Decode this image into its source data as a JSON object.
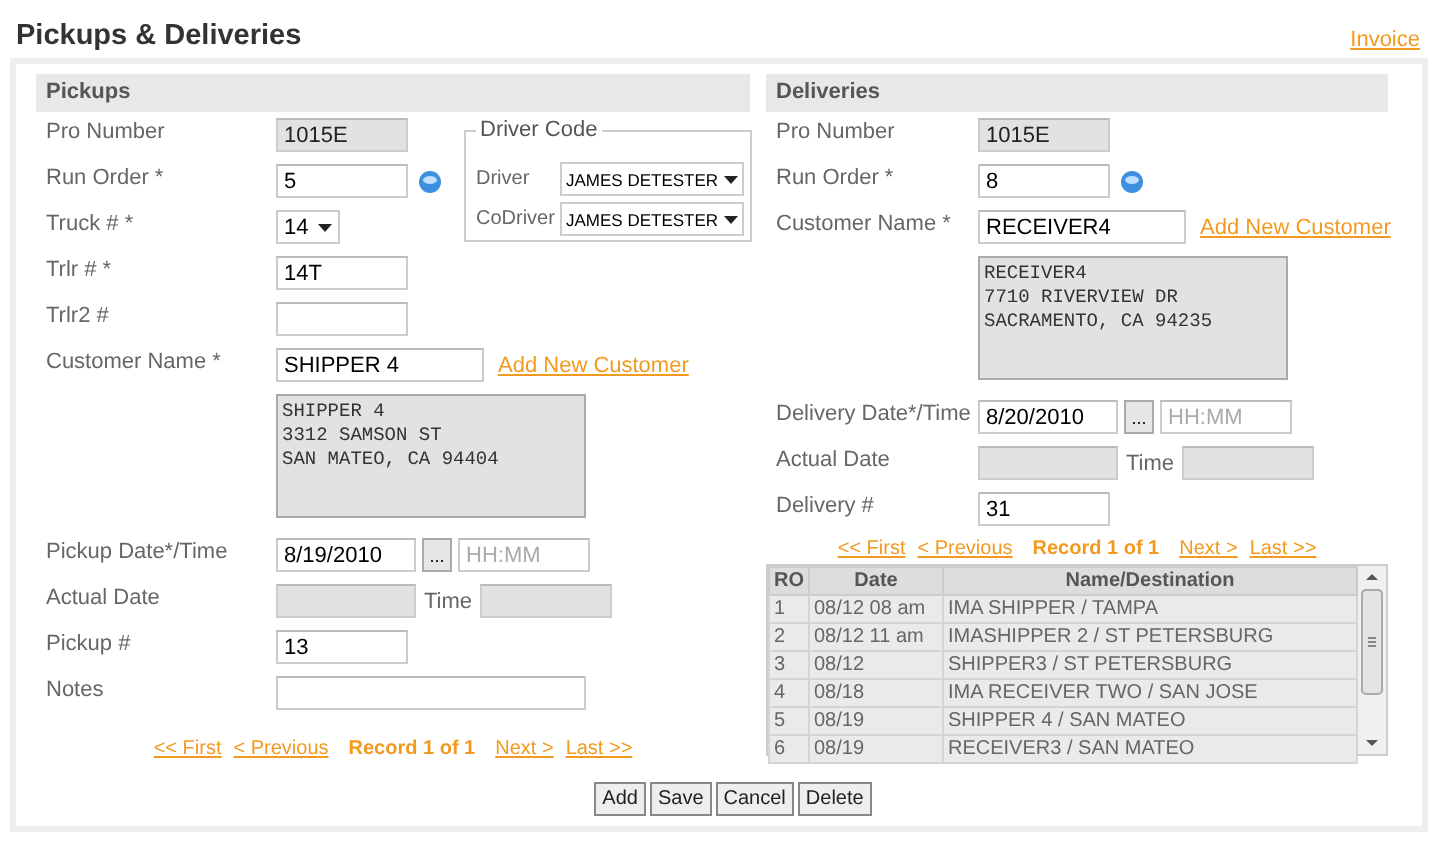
{
  "title": "Pickups & Deliveries",
  "invoice_link": "Invoice",
  "pickups": {
    "heading": "Pickups",
    "fields": [
      {
        "kind": "readonly",
        "label": "Pro Number",
        "value": "1015E"
      },
      {
        "kind": "lookup",
        "label": "Run Order *",
        "value": "5"
      },
      {
        "kind": "select",
        "label": "Truck # *",
        "value": "14"
      },
      {
        "kind": "text",
        "label": "Trlr # *",
        "value": "14T"
      },
      {
        "kind": "text",
        "label": "Trlr2 #"
      },
      {
        "kind": "customer",
        "label": "Customer Name *",
        "value": "SHIPPER 4",
        "link": "Add New Customer"
      },
      {
        "kind": "address",
        "value": "SHIPPER 4\n3312 SAMSON ST\nSAN MATEO, CA 94404"
      },
      {
        "kind": "date",
        "label": "Pickup Date*/Time",
        "value": "8/19/2010",
        "button": "...",
        "placeholder": "HH:MM"
      },
      {
        "kind": "actual",
        "label": "Actual Date",
        "time_label": "Time"
      },
      {
        "kind": "text",
        "label": "Pickup #",
        "value": "13"
      },
      {
        "kind": "wide",
        "label": "Notes"
      }
    ],
    "driver_code": {
      "legend": "Driver Code",
      "rows": [
        {
          "label": "Driver",
          "value": "JAMES DETESTER"
        },
        {
          "label": "CoDriver",
          "value": "JAMES DETESTER"
        }
      ]
    },
    "pager": {
      "first": "<< First",
      "previous": "< Previous",
      "record": "Record 1 of 1",
      "next": "Next >",
      "last": "Last >>"
    }
  },
  "deliveries": {
    "heading": "Deliveries",
    "fields": [
      {
        "kind": "readonly",
        "label": "Pro Number",
        "value": "1015E"
      },
      {
        "kind": "lookup",
        "label": "Run Order *",
        "value": "8"
      },
      {
        "kind": "customer",
        "label": "Customer Name *",
        "value": "RECEIVER4",
        "link": "Add New Customer"
      },
      {
        "kind": "address",
        "value": "RECEIVER4\n7710 RIVERVIEW DR\nSACRAMENTO, CA 94235"
      },
      {
        "kind": "date",
        "label": "Delivery Date*/Time",
        "value": "8/20/2010",
        "button": "...",
        "placeholder": "HH:MM"
      },
      {
        "kind": "actual",
        "label": "Actual Date",
        "time_label": "Time"
      },
      {
        "kind": "text",
        "label": "Delivery #",
        "value": "31"
      }
    ],
    "pager": {
      "first": "<< First",
      "previous": "< Previous",
      "record": "Record 1 of 1",
      "next": "Next >",
      "last": "Last >>"
    },
    "table": {
      "columns": [
        "RO",
        "Date",
        "Name/Destination"
      ],
      "rows": [
        [
          "1",
          "08/12 08 am",
          "IMA SHIPPER / TAMPA"
        ],
        [
          "2",
          "08/12 11 am",
          "IMASHIPPER 2 / ST PETERSBURG"
        ],
        [
          "3",
          "08/12",
          "SHIPPER3 / ST PETERSBURG"
        ],
        [
          "4",
          "08/18",
          "IMA RECEIVER TWO / SAN JOSE"
        ],
        [
          "5",
          "08/19",
          "SHIPPER 4 / SAN MATEO"
        ],
        [
          "6",
          "08/19",
          "RECEIVER3 / SAN MATEO"
        ]
      ]
    }
  },
  "buttons": [
    "Add",
    "Save",
    "Cancel",
    "Delete"
  ]
}
